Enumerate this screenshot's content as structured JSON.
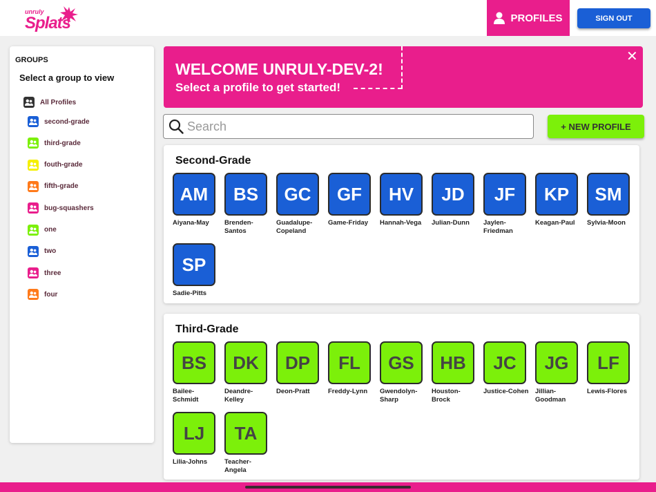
{
  "header": {
    "logo_small": "unruly",
    "logo_big": "Splats",
    "profiles_label": "PROFILES",
    "signout_label": "SIGN OUT"
  },
  "sidebar": {
    "groups_heading": "GROUPS",
    "select_label": "Select a group to view",
    "all_profiles": "All Profiles",
    "items": [
      {
        "label": "second-grade",
        "color": "#1a5fd6"
      },
      {
        "label": "third-grade",
        "color": "#7cf00a"
      },
      {
        "label": "fouth-grade",
        "color": "#f5f000"
      },
      {
        "label": "fifth-grade",
        "color": "#ff7a1a"
      },
      {
        "label": "bug-squashers",
        "color": "#e91e8c"
      },
      {
        "label": "one",
        "color": "#7cf00a"
      },
      {
        "label": "two",
        "color": "#1a5fd6"
      },
      {
        "label": "three",
        "color": "#e91e8c"
      },
      {
        "label": "four",
        "color": "#ff7a1a"
      }
    ]
  },
  "banner": {
    "title": "WELCOME UNRULY-DEV-2!",
    "subtitle": "Select a profile to get started!",
    "close": "✕"
  },
  "search": {
    "placeholder": "Search"
  },
  "new_profile_label": "+ NEW PROFILE",
  "groups": [
    {
      "title": "Second-Grade",
      "color": "blue",
      "profiles": [
        {
          "initials": "AM",
          "name": "Aiyana-May"
        },
        {
          "initials": "BS",
          "name": "Brenden-Santos"
        },
        {
          "initials": "GC",
          "name": "Guadalupe-Copeland"
        },
        {
          "initials": "GF",
          "name": "Game-Friday"
        },
        {
          "initials": "HV",
          "name": "Hannah-Vega"
        },
        {
          "initials": "JD",
          "name": "Julian-Dunn"
        },
        {
          "initials": "JF",
          "name": "Jaylen-Friedman"
        },
        {
          "initials": "KP",
          "name": "Keagan-Paul"
        },
        {
          "initials": "SM",
          "name": "Sylvia-Moon"
        },
        {
          "initials": "SP",
          "name": "Sadie-Pitts"
        }
      ]
    },
    {
      "title": "Third-Grade",
      "color": "green",
      "profiles": [
        {
          "initials": "BS",
          "name": "Bailee-Schmidt"
        },
        {
          "initials": "DK",
          "name": "Deandre-Kelley"
        },
        {
          "initials": "DP",
          "name": "Deon-Pratt"
        },
        {
          "initials": "FL",
          "name": "Freddy-Lynn"
        },
        {
          "initials": "GS",
          "name": "Gwendolyn-Sharp"
        },
        {
          "initials": "HB",
          "name": "Houston-Brock"
        },
        {
          "initials": "JC",
          "name": "Justice-Cohen"
        },
        {
          "initials": "JG",
          "name": "Jillian-Goodman"
        },
        {
          "initials": "LF",
          "name": "Lewis-Flores"
        },
        {
          "initials": "LJ",
          "name": "Lilia-Johns"
        },
        {
          "initials": "TA",
          "name": "Teacher-Angela"
        }
      ]
    }
  ]
}
